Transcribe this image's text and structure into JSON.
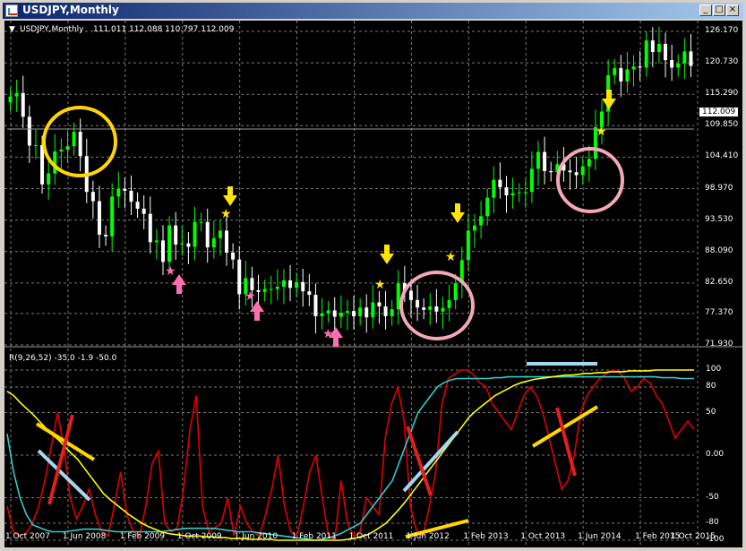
{
  "window": {
    "title": "USDJPY,Monthly",
    "controls": {
      "minimize": "_",
      "maximize": "□",
      "close": "×"
    }
  },
  "main_pane": {
    "info_marker": "▼",
    "symbol": "USDJPY,Monthly",
    "ohlc": "111.011 112.088 110.797 112.009",
    "price_labels": [
      "126.170",
      "120.730",
      "115.290",
      "109.850",
      "104.410",
      "98.970",
      "93.530",
      "88.090",
      "82.650",
      "77.370",
      "71.930"
    ],
    "current_price": "112.009"
  },
  "indicator_pane": {
    "header": "R(9,26,52) -35.0 -1.9 -50.0",
    "levels": [
      "100",
      "80",
      "50",
      "0.00",
      "-50",
      "-80",
      "-100"
    ]
  },
  "time_axis": [
    "1 Oct 2007",
    "1 Jun 2008",
    "1 Feb 2009",
    "1 Oct 2009",
    "1 Jun 2010",
    "1 Feb 2011",
    "1 Oct 2011",
    "1 Jun 2012",
    "1 Feb 2013",
    "1 Oct 2013",
    "1 Jun 2014",
    "1 Feb 2015",
    "1 Oct 2015"
  ],
  "colors": {
    "background": "#000000",
    "grid": "#7a7a7a",
    "bull_candle": "#00ff00",
    "bear_candle": "#ffffff",
    "red_line": "#e00000",
    "cyan_line": "#33cccc",
    "yellow_line": "#ffff00",
    "annotation_yellow": "#ffd700",
    "annotation_pink": "#f4a7b9",
    "annotation_lightblue": "#a4d8f0",
    "arrow_pink": "#ff6fae",
    "arrow_yellow": "#ffe600"
  },
  "chart_data": {
    "type": "candlestick",
    "monthly_closes": [
      114.9,
      115.5,
      111.4,
      106.4,
      106.5,
      99.7,
      101.6,
      105.4,
      105.7,
      106.3,
      108.8,
      104.6,
      98.4,
      96.8,
      91.0,
      90.7,
      97.6,
      98.9,
      98.6,
      96.7,
      95.5,
      94.6,
      89.7,
      90.0,
      86.3,
      92.6,
      89.3,
      89.5,
      88.9,
      93.2,
      93.2,
      88.8,
      90.4,
      91.7,
      87.9,
      86.7,
      80.7,
      83.5,
      81.4,
      81.1,
      81.6,
      81.6,
      82.0,
      83.1,
      81.8,
      82.8,
      81.2,
      80.6,
      76.9,
      77.4,
      77.9,
      76.8,
      77.5,
      77.8,
      76.9,
      78.4,
      76.7,
      79.3,
      78.6,
      76.9,
      78.1,
      82.6,
      81.3,
      79.7,
      78.4,
      78.0,
      78.6,
      77.7,
      78.3,
      79.7,
      82.6,
      86.6,
      91.7,
      92.6,
      94.2,
      97.4,
      100.5,
      99.2,
      97.8,
      98.2,
      98.3,
      98.4,
      102.4,
      105.3,
      102.0,
      101.8,
      103.2,
      102.1,
      101.8,
      101.3,
      102.8,
      104.1,
      109.6,
      112.3,
      118.6,
      119.8,
      117.5,
      119.6,
      120.1,
      119.9,
      124.6,
      122.6,
      124.0,
      121.2,
      119.9,
      120.6,
      122.7,
      120.2
    ],
    "price_scale": {
      "min": 71.93,
      "max": 126.17
    },
    "rsi_series": [
      {
        "name": "red",
        "values": [
          -60,
          -90,
          -95,
          -92,
          -80,
          -60,
          -30,
          10,
          50,
          10,
          -50,
          -75,
          -60,
          -40,
          -70,
          -90,
          -95,
          -60,
          -20,
          -70,
          -90,
          -95,
          -60,
          -10,
          5,
          -80,
          -90,
          -85,
          -40,
          30,
          70,
          -60,
          -90,
          -85,
          -80,
          -50,
          -95,
          -60,
          -80,
          -90,
          -95,
          -70,
          -40,
          0,
          -60,
          -90,
          -95,
          -60,
          -20,
          0,
          -50,
          -95,
          -100,
          -30,
          -80,
          -95,
          -90,
          -50,
          -60,
          -70,
          20,
          60,
          80,
          40,
          -60,
          -90,
          -95,
          -60,
          -20,
          60,
          90,
          95,
          100,
          100,
          95,
          85,
          80,
          60,
          50,
          40,
          30,
          50,
          70,
          80,
          70,
          50,
          20,
          -10,
          -40,
          -30,
          0,
          50,
          70,
          80,
          90,
          95,
          100,
          98,
          90,
          75,
          80,
          90,
          85,
          70,
          60,
          40,
          20,
          30,
          40,
          30
        ]
      },
      {
        "name": "cyan",
        "values": [
          25,
          -20,
          -50,
          -70,
          -82,
          -85,
          -88,
          -90,
          -90,
          -90,
          -89,
          -88,
          -87,
          -87,
          -87,
          -88,
          -89,
          -90,
          -90,
          -90,
          -90,
          -90,
          -90,
          -90,
          -90,
          -89,
          -88,
          -87,
          -86,
          -86,
          -86,
          -86,
          -86,
          -87,
          -88,
          -89,
          -90,
          -90,
          -90,
          -91,
          -92,
          -93,
          -94,
          -95,
          -96,
          -97,
          -98,
          -99,
          -100,
          -99,
          -97,
          -95,
          -92,
          -88,
          -84,
          -80,
          -70,
          -60,
          -50,
          -40,
          -30,
          -10,
          10,
          30,
          50,
          60,
          70,
          80,
          85,
          88,
          90,
          90,
          90,
          90,
          90,
          90,
          91,
          91,
          92,
          92,
          92,
          92,
          92,
          92,
          92,
          92,
          92,
          92,
          92,
          92,
          92,
          92,
          92,
          92,
          92,
          92,
          92,
          92,
          92,
          92,
          92,
          92,
          91,
          91,
          91,
          90,
          90,
          90
        ]
      },
      {
        "name": "yellow",
        "values": [
          75,
          70,
          62,
          55,
          48,
          40,
          32,
          24,
          18,
          10,
          2,
          -5,
          -15,
          -25,
          -35,
          -45,
          -52,
          -58,
          -64,
          -70,
          -75,
          -80,
          -84,
          -87,
          -90,
          -92,
          -93,
          -94,
          -95,
          -95,
          -95,
          -96,
          -96,
          -97,
          -97,
          -98,
          -98,
          -98,
          -99,
          -99,
          -99,
          -99,
          -100,
          -100,
          -100,
          -100,
          -100,
          -100,
          -100,
          -100,
          -100,
          -100,
          -100,
          -99,
          -98,
          -96,
          -94,
          -90,
          -85,
          -80,
          -72,
          -64,
          -55,
          -45,
          -35,
          -25,
          -15,
          -5,
          5,
          15,
          25,
          35,
          45,
          52,
          58,
          64,
          70,
          74,
          78,
          82,
          85,
          87,
          89,
          90,
          91,
          92,
          93,
          94,
          94,
          95,
          96,
          96,
          97,
          97,
          98,
          98,
          98,
          99,
          99,
          99,
          99,
          100,
          100,
          100,
          100,
          100,
          100,
          100
        ]
      }
    ],
    "rsi_scale": {
      "min": -100,
      "max": 100
    }
  }
}
